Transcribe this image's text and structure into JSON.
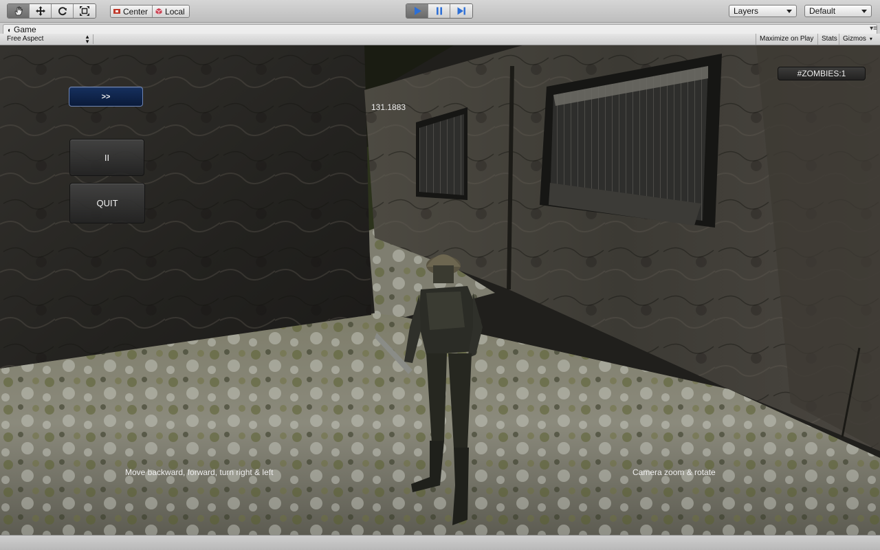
{
  "toolbar": {
    "transform_tools": [
      {
        "name": "hand-tool-icon"
      },
      {
        "name": "move-tool-icon"
      },
      {
        "name": "rotate-tool-icon"
      },
      {
        "name": "scale-tool-icon"
      }
    ],
    "pivot_center_label": "Center",
    "pivot_local_label": "Local",
    "playback": [
      "play-icon",
      "pause-icon",
      "step-icon"
    ],
    "layers_label": "Layers",
    "layout_label": "Default",
    "accent_color": "#2d6fd6"
  },
  "game_panel": {
    "tab_label": "Game",
    "aspect_label": "Free Aspect",
    "maximize_label": "Maximize on Play",
    "stats_label": "Stats",
    "gizmos_label": "Gizmos"
  },
  "hud": {
    "next_button_label": ">>",
    "pause_button_label": "II",
    "quit_button_label": "QUIT",
    "timer_text": "131.1883",
    "zombies_text": "#ZOMBIES:1",
    "move_hint": "Move backward, forward, turn right & left",
    "camera_hint": "Camera zoom & rotate"
  }
}
